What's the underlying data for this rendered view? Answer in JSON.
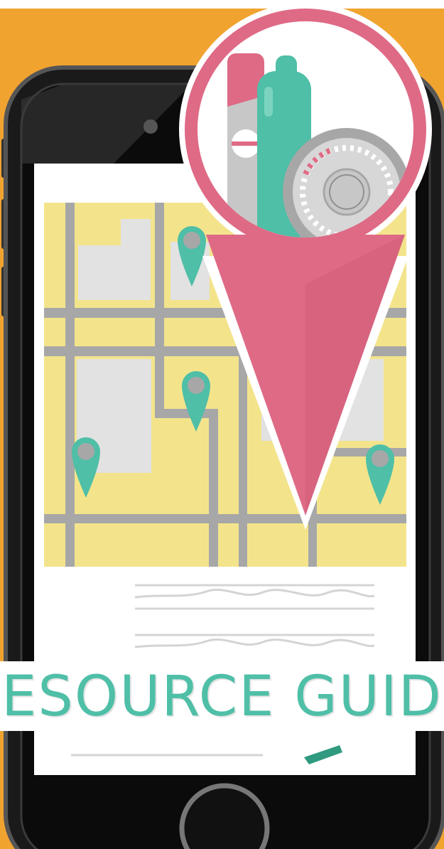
{
  "banner": {
    "text": "ESOURCE GUID"
  },
  "colors": {
    "background_orange": "#f1a330",
    "phone_body": "#1a1a1a",
    "map_yellow": "#f3e48c",
    "road_gray": "#a7a7a7",
    "block_gray": "#e2e2e2",
    "map_pin_teal": "#4fbfa7",
    "large_pin_pink": "#df6a86",
    "banner_text_teal": "#4fbfa7"
  },
  "icons": {
    "large_pin": "location-pin-icon",
    "map_pins": "map-marker-icon",
    "contraceptive_items": [
      "condom-wrapper-icon",
      "inhaler-device-icon",
      "pill-dial-pack-icon"
    ]
  }
}
